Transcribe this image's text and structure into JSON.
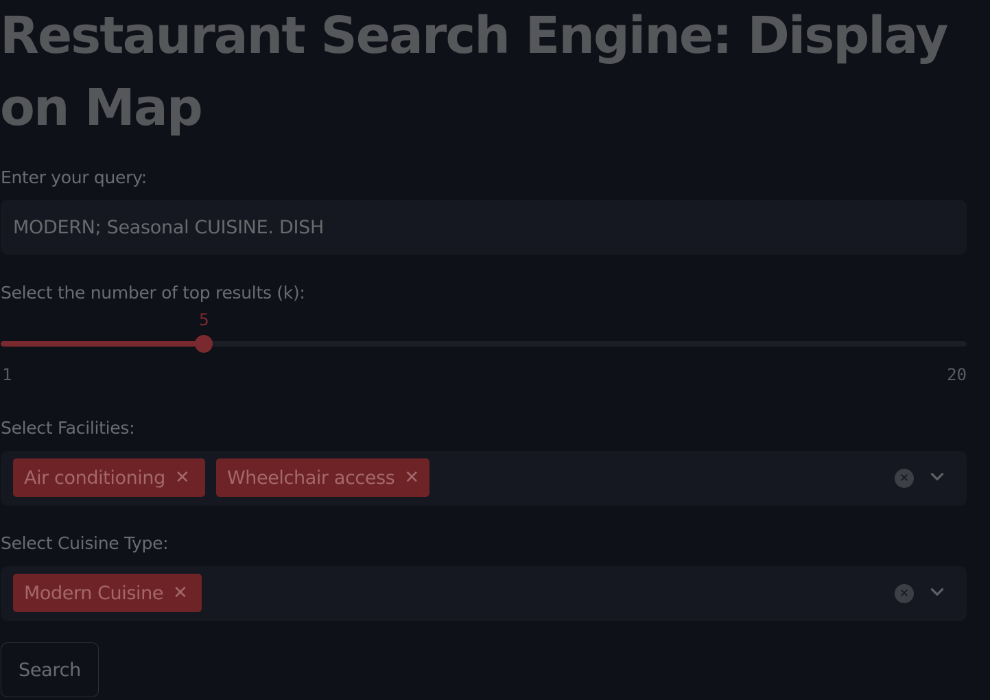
{
  "page_title": "Restaurant Search Engine: Display on Map",
  "query": {
    "label": "Enter your query:",
    "value": "MODERN; Seasonal CUISINE. DISH"
  },
  "k_slider": {
    "label": "Select the number of top results (k):",
    "value": 5,
    "min": 1,
    "max": 20
  },
  "facilities": {
    "label": "Select Facilities:",
    "selected": [
      "Air conditioning",
      "Wheelchair access"
    ]
  },
  "cuisine": {
    "label": "Select Cuisine Type:",
    "selected": [
      "Modern Cuisine"
    ]
  },
  "search_button_label": "Search",
  "icons": {
    "chip_remove": "close-icon",
    "clear_all": "clear-circle-icon",
    "dropdown": "chevron-down-icon"
  },
  "colors": {
    "background": "#0e1117",
    "accent": "#7a2a2f",
    "chip": "#6e2326",
    "input_background": "#151820"
  }
}
